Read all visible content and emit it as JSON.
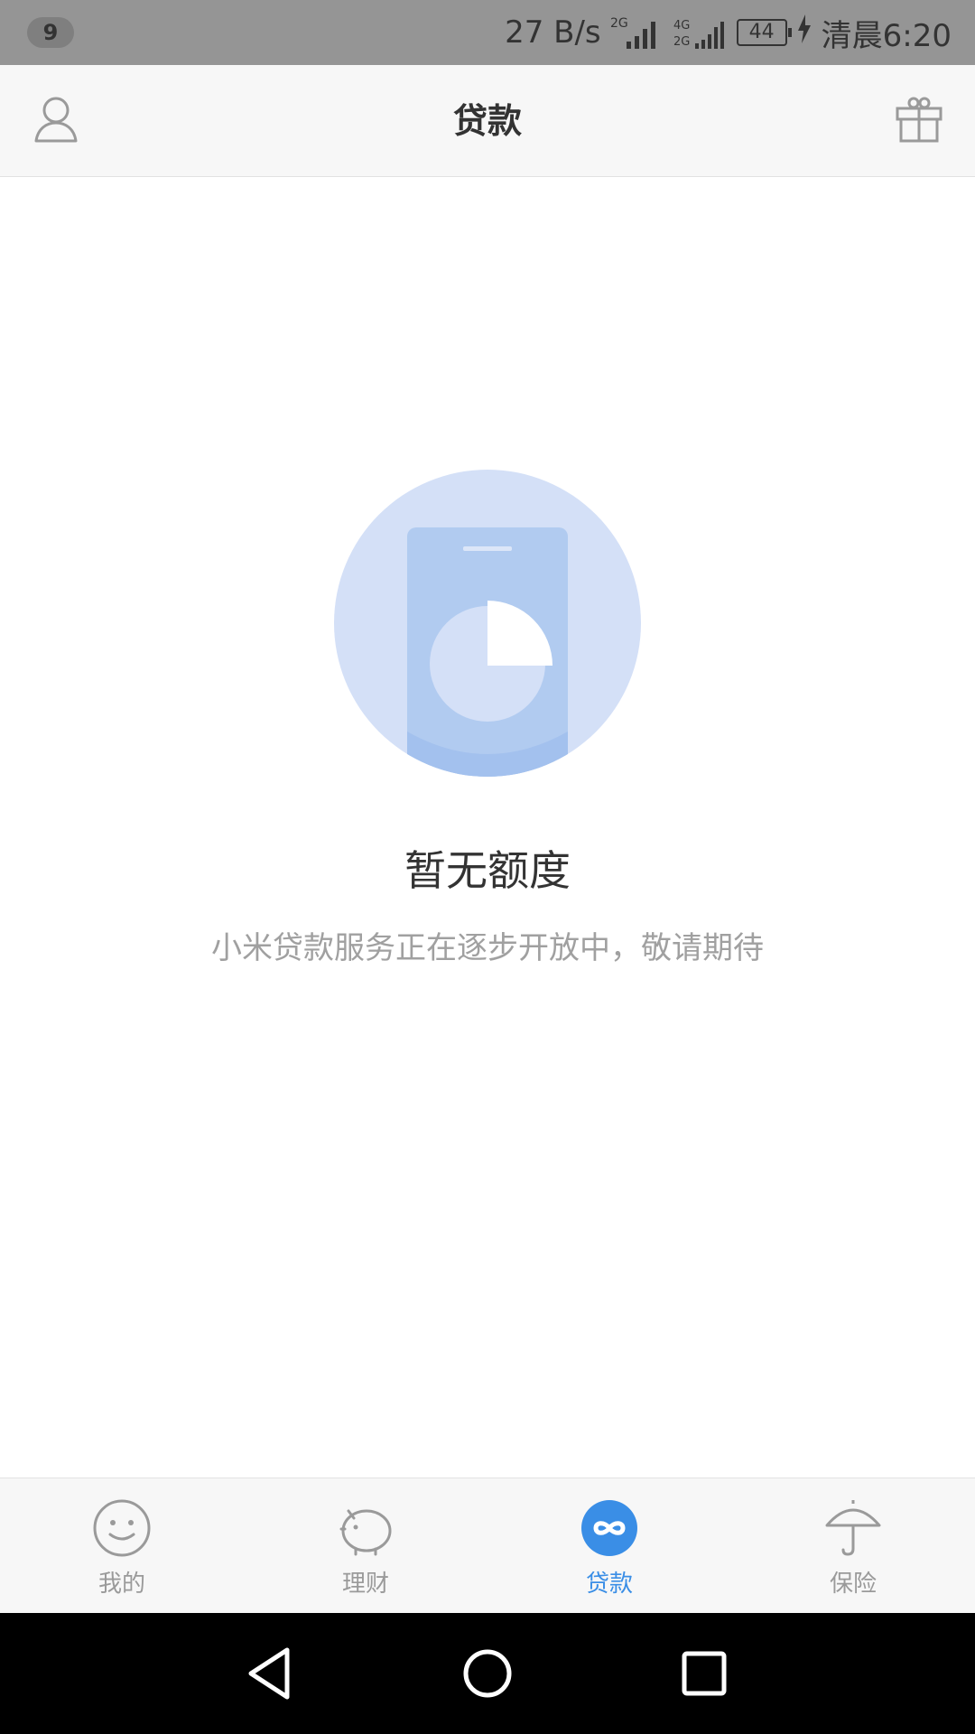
{
  "status_bar": {
    "notification_count": "9",
    "net_speed": "27 B/s",
    "sim1_label": "2G",
    "sim2_label_top": "4G",
    "sim2_label_bottom": "2G",
    "battery": "44",
    "time": "清晨6:20"
  },
  "header": {
    "title": "贷款",
    "left_icon": "user-icon",
    "right_icon": "gift-icon"
  },
  "empty_state": {
    "title": "暂无额度",
    "subtitle": "小米贷款服务正在逐步开放中，敬请期待",
    "colors": {
      "circle": "#d4e0f7",
      "phone": "#b1cbf0",
      "dark": "#a3c1ee"
    }
  },
  "tabs": [
    {
      "label": "我的",
      "icon": "smiley-icon",
      "active": false
    },
    {
      "label": "理财",
      "icon": "piggy-bank-icon",
      "active": false
    },
    {
      "label": "贷款",
      "icon": "infinity-icon",
      "active": true
    },
    {
      "label": "保险",
      "icon": "umbrella-icon",
      "active": false
    }
  ],
  "colors": {
    "accent": "#3a8ee6",
    "inactive": "#9a9a9a"
  },
  "nav": {
    "back_icon": "back-icon",
    "home_icon": "home-icon",
    "recent_icon": "recent-apps-icon"
  }
}
